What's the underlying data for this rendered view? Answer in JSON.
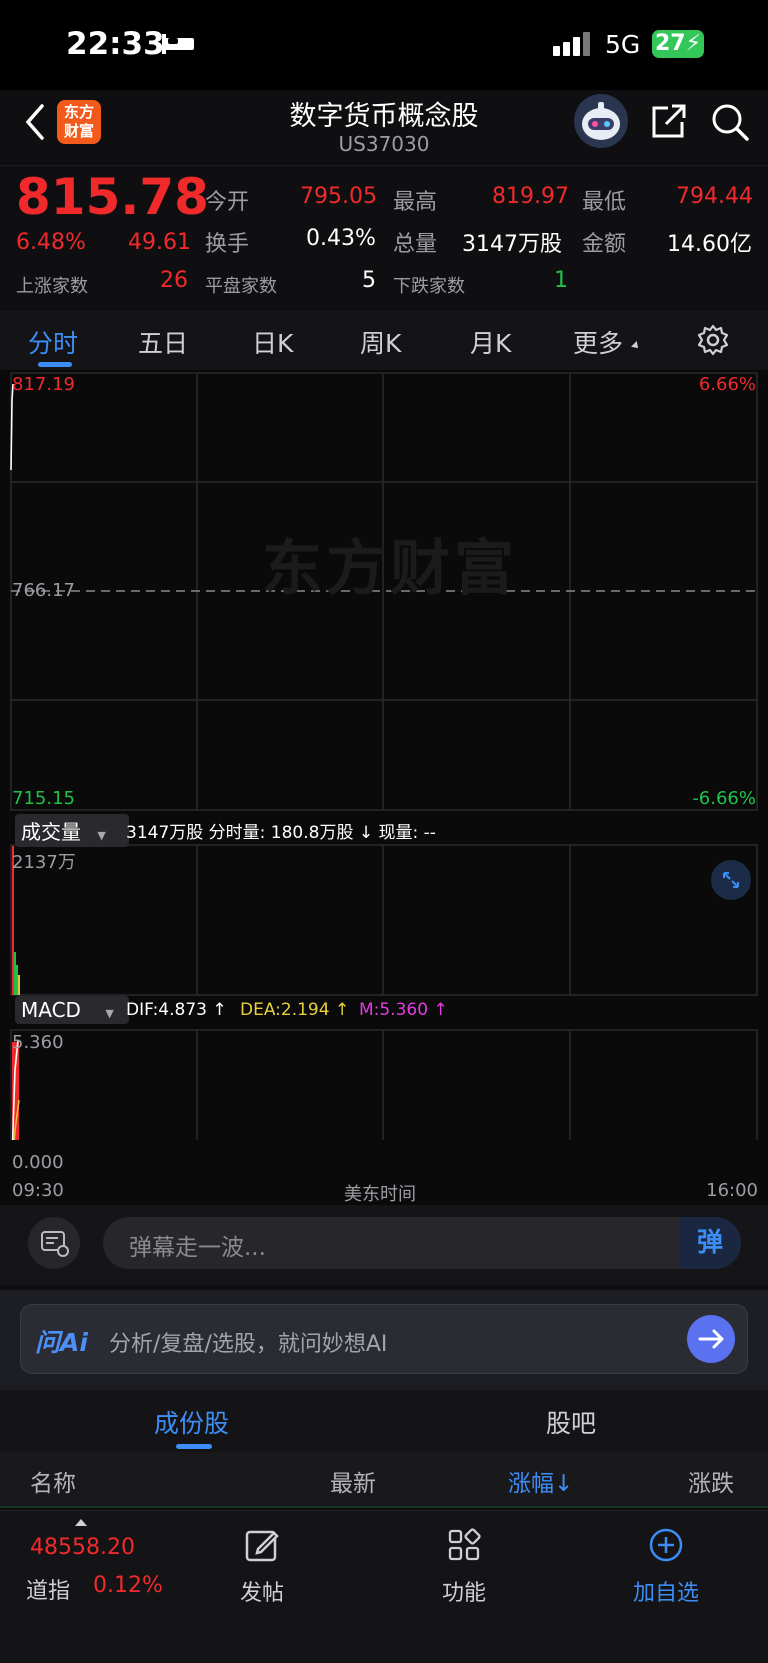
{
  "status_bar": {
    "time": "22:33",
    "network": "5G",
    "battery": "27"
  },
  "header": {
    "title": "数字货币概念股",
    "subtitle": "US37030",
    "logo_line1": "东方",
    "logo_line2": "财富"
  },
  "quote": {
    "price": "815.78",
    "change_pct": "6.48%",
    "change_abs": "49.61",
    "rows": [
      [
        {
          "label": "今开",
          "value": "795.05"
        },
        {
          "label": "最高",
          "value": "819.97"
        },
        {
          "label": "最低",
          "value": "794.44"
        }
      ],
      [
        {
          "label": "换手",
          "value": "0.43%"
        },
        {
          "label": "总量",
          "value": "3147万股"
        },
        {
          "label": "金额",
          "value": "14.60亿"
        }
      ]
    ],
    "breadth": [
      {
        "label": "上涨家数",
        "value": "26"
      },
      {
        "label": "平盘家数",
        "value": "5"
      },
      {
        "label": "下跌家数",
        "value": "1"
      }
    ]
  },
  "tabs": [
    "分时",
    "五日",
    "日K",
    "周K",
    "月K",
    "更多"
  ],
  "chart": {
    "top_price": "817.19",
    "mid_price": "766.17",
    "bottom_price": "715.15",
    "top_pct": "6.66%",
    "bottom_pct": "-6.66%",
    "watermark": "东方财富",
    "volume_label": "成交量",
    "volume_info": "3147万股 分时量: 180.8万股 ↓ 现量: --",
    "volume_max": "2137万",
    "macd_label": "MACD",
    "dif": "DIF:4.873 ↑",
    "dea": "DEA:2.194 ↑",
    "m": "M:5.360 ↑",
    "macd_top": "5.360",
    "macd_bottom": "0.000",
    "time_start": "09:30",
    "time_mid": "美东时间",
    "time_end": "16:00"
  },
  "comment": {
    "placeholder": "弹幕走一波...",
    "send_label": "弹"
  },
  "ai": {
    "brand": "问Ai",
    "placeholder": "分析/复盘/选股，就问妙想AI"
  },
  "constituents": {
    "tabs": [
      "成份股",
      "股吧"
    ],
    "headers": [
      "名称",
      "最新",
      "涨幅↓",
      "涨跌"
    ]
  },
  "bottom": {
    "index_value": "48558.20",
    "index_name": "道指",
    "index_pct": "0.12%",
    "nav": [
      "发帖",
      "功能",
      "加自选"
    ]
  }
}
